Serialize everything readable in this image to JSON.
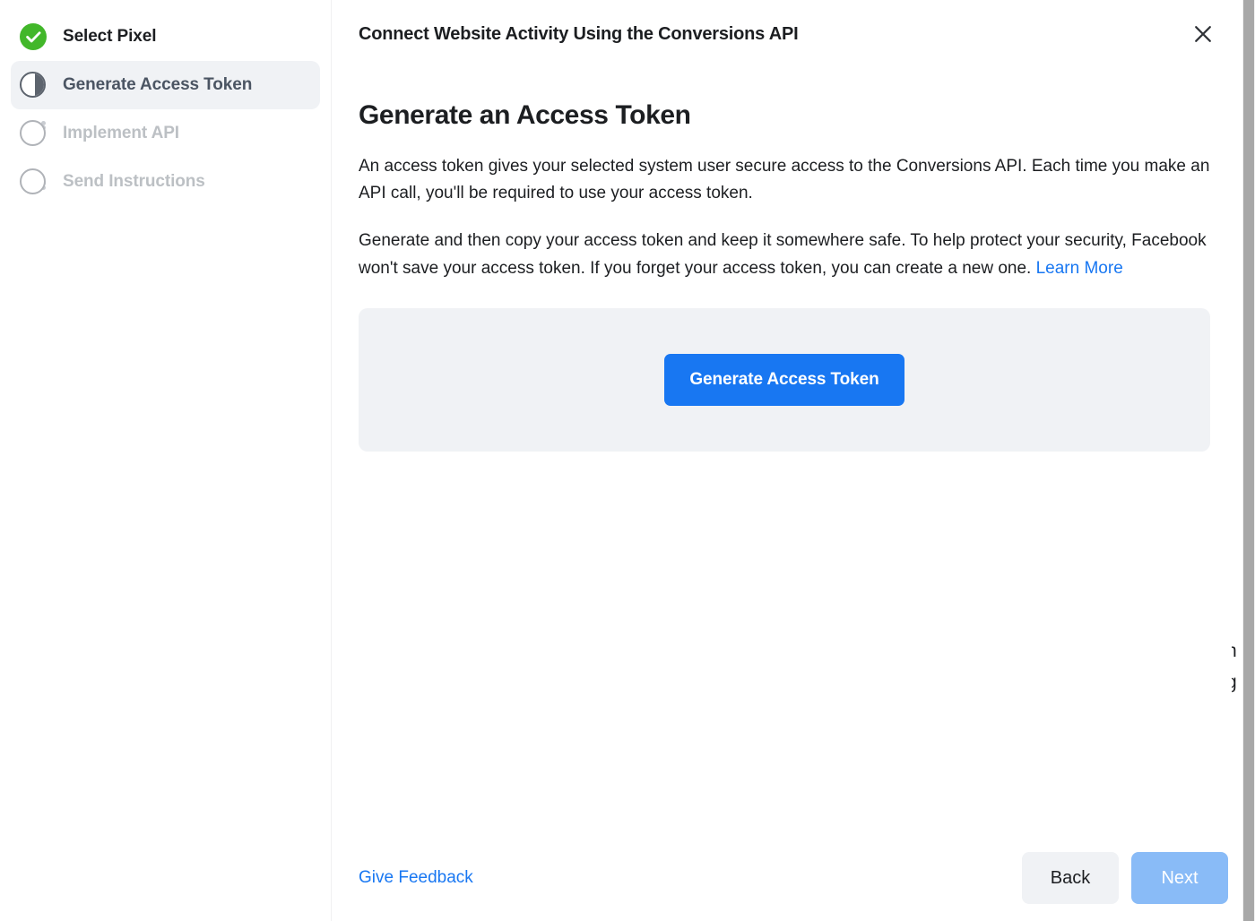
{
  "sidebar": {
    "steps": [
      {
        "label": "Select Pixel",
        "state": "complete",
        "icon": "check-circle-icon"
      },
      {
        "label": "Generate Access Token",
        "state": "active",
        "icon": "half-circle-icon"
      },
      {
        "label": "Implement API",
        "state": "upcoming",
        "icon": "empty-circle-icon"
      },
      {
        "label": "Send Instructions",
        "state": "upcoming",
        "icon": "empty-circle-icon"
      }
    ]
  },
  "header": {
    "title": "Connect Website Activity Using the Conversions API",
    "close_icon": "close-icon"
  },
  "main": {
    "section_title": "Generate an Access Token",
    "paragraph_1": "An access token gives your selected system user secure access to the Conversions API. Each time you make an API call, you'll be required to use your access token.",
    "paragraph_2_text": "Generate and then copy your access token and keep it somewhere safe. To help protect your security, Facebook won't save your access token. If you forget your access token, you can create a new one.",
    "paragraph_2_link": "Learn More",
    "generate_button": "Generate Access Token"
  },
  "footer": {
    "feedback_label": "Give Feedback",
    "back_label": "Back",
    "next_label": "Next"
  },
  "background_peek": {
    "line_1": "n",
    "line_2": "g"
  },
  "colors": {
    "accent_blue": "#1877F2",
    "next_disabled_blue": "#89BBF7",
    "complete_green": "#42B72A",
    "active_step_gray": "#5D646E",
    "upcoming_gray": "#BCC0C4",
    "panel_gray": "#F0F2F5",
    "text_primary": "#1C1E21"
  }
}
